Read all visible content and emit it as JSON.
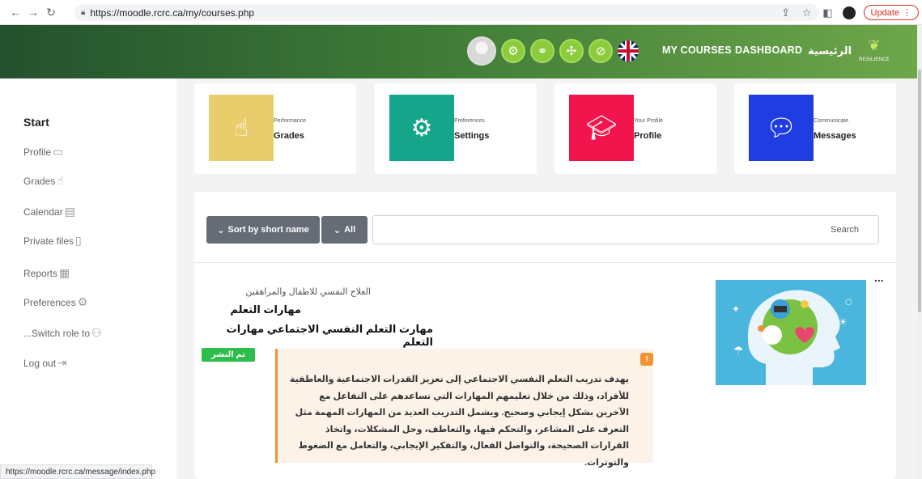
{
  "browser": {
    "url": "https://moodle.rcrc.ca/my/courses.php",
    "update_label": "Update",
    "status_url": "https://moodle.rcrc.ca/message/index.php"
  },
  "header": {
    "nav_courses": "MY COURSES",
    "nav_dashboard": "DASHBOARD",
    "nav_home": "الرئيسية",
    "logo_text": "RESILIENCE",
    "accent_color": "#8ccc3c",
    "gradient": [
      "#24512e",
      "#6ea64a"
    ]
  },
  "sidebar": {
    "start": "Start",
    "items": [
      {
        "label": "Profile",
        "icon": "id-card-icon"
      },
      {
        "label": "Grades",
        "icon": "grades-icon"
      },
      {
        "label": "Calendar",
        "icon": "calendar-icon"
      },
      {
        "label": "Private files",
        "icon": "file-icon"
      },
      {
        "label": "Reports",
        "icon": "reports-icon"
      },
      {
        "label": "Preferences",
        "icon": "gear-icon"
      },
      {
        "label": "...Switch role to",
        "icon": "users-icon"
      },
      {
        "label": "Log out",
        "icon": "logout-icon"
      }
    ]
  },
  "tiles": [
    {
      "sub": "Performance",
      "title": "Grades",
      "color": "#e9cc6b",
      "icon": "grades-icon"
    },
    {
      "sub": "Preferences",
      "title": "Settings",
      "color": "#15a58a",
      "icon": "gear-icon"
    },
    {
      "sub": "Your Profile",
      "title": "Profile",
      "color": "#f1144d",
      "icon": "graduation-cap-icon"
    },
    {
      "sub": "Communicate",
      "title": "Messages",
      "color": "#1f3de0",
      "icon": "chat-icon"
    }
  ],
  "controls": {
    "sort_label": "Sort by short name",
    "filter_label": "All",
    "search_placeholder": "Search"
  },
  "course": {
    "category": "العلاج النفسي للاطفال والمراهقين",
    "short_name": "مهارات التعلم",
    "full_name": "مهارت التعلم النفسي الاجتماعي مهارات التعلم",
    "status": "تم النشر",
    "summary": "يهدف تدريب التعلم النفسي الاجتماعي إلى تعزيز القدرات الاجتماعية والعاطفية للأفراد، وذلك من خلال تعليمهم المهارات التي تساعدهم على التفاعل مع الآخرين بشكل إيجابي وصحيح. ويشمل التدريب العديد من المهارات المهمة مثل التعرف على المشاعر، والتحكم فيها، والتعاطف، وحل المشكلات، واتخاذ القرارات الصحيحة، والتواصل الفعال، والتفكير الإيجابي، والتعامل مع الضغوط والتوترات.",
    "more": "..."
  }
}
